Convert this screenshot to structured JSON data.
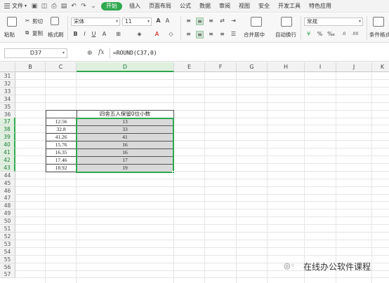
{
  "menubar": {
    "file_label": "文件",
    "items": [
      "开始",
      "插入",
      "页面布局",
      "公式",
      "数据",
      "审阅",
      "视图",
      "安全",
      "开发工具",
      "特色应用"
    ],
    "active_index": 0,
    "accent": "#2fa84f"
  },
  "ribbon": {
    "paste": "粘贴",
    "cut": "剪切",
    "copy": "复制",
    "format_painter": "格式刷",
    "font_name": "宋体",
    "font_size": "11",
    "merge_center": "合并居中",
    "wrap_text": "自动换行",
    "number_format": "常规",
    "conditional_format": "条件格式"
  },
  "formula_bar": {
    "name_box": "D37",
    "fx": "fx",
    "formula": "=ROUND(C37,0)"
  },
  "grid": {
    "columns": [
      "B",
      "C",
      "D",
      "E",
      "F",
      "G",
      "H",
      "I",
      "J",
      "K"
    ],
    "selected_column": "D",
    "rows": [
      "31",
      "32",
      "33",
      "34",
      "35",
      "36",
      "37",
      "38",
      "39",
      "40",
      "41",
      "42",
      "43",
      "44",
      "45",
      "46",
      "47",
      "48",
      "49",
      "50",
      "51",
      "52",
      "53",
      "54",
      "55",
      "56",
      "57"
    ],
    "selected_rows": [
      "37",
      "38",
      "39",
      "40",
      "41",
      "42",
      "43"
    ]
  },
  "table": {
    "header_d": "四舍五入保留0位小数",
    "c_values": [
      "12.56",
      "32.8",
      "41.26",
      "15.76",
      "16.35",
      "17.46",
      "18.92"
    ],
    "d_values": [
      "13",
      "33",
      "41",
      "16",
      "16",
      "17",
      "19"
    ]
  },
  "watermark": {
    "text": "在线办公软件课程"
  }
}
